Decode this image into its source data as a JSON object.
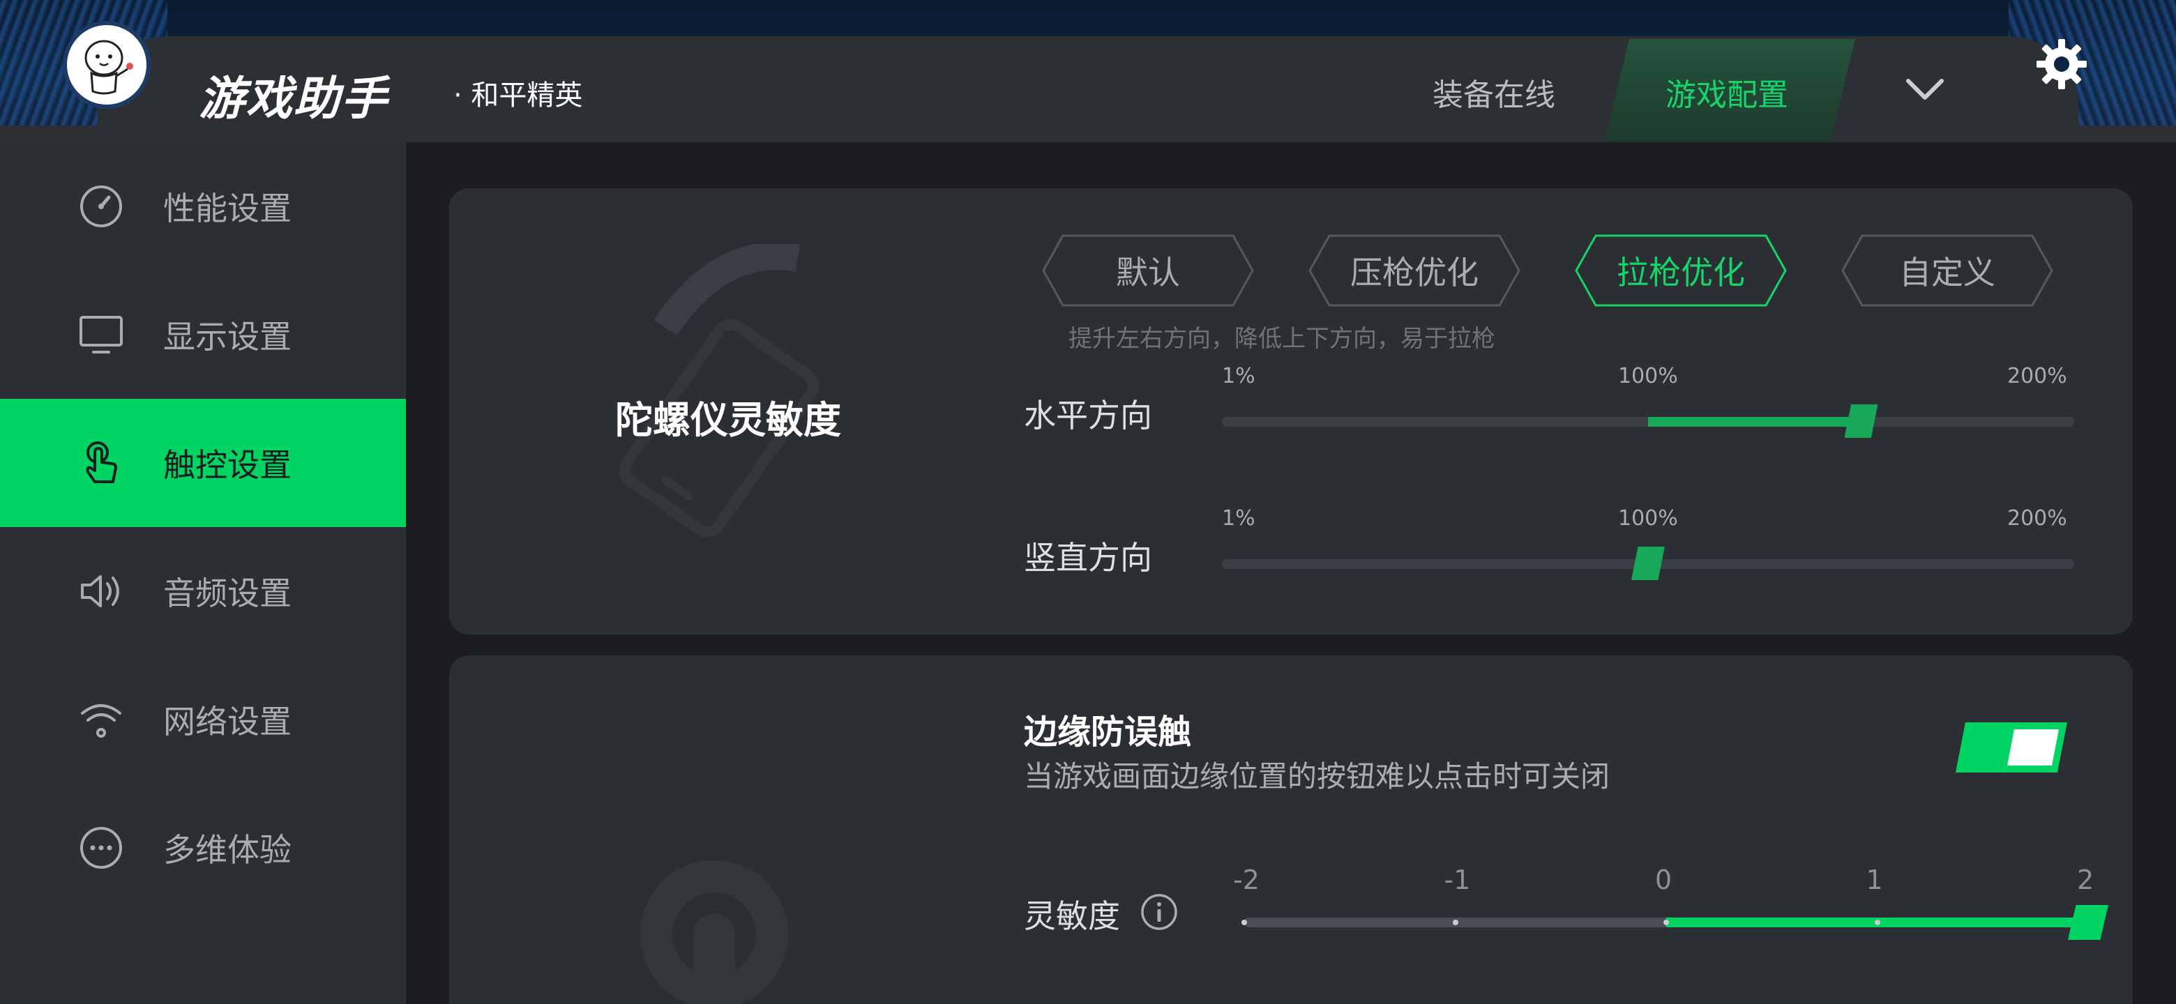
{
  "header": {
    "logo_text": "游戏助手",
    "game_name": "· 和平精英",
    "tabs": [
      {
        "label": "装备在线",
        "active": false
      },
      {
        "label": "游戏配置",
        "active": true
      }
    ],
    "accent": "#17d46a"
  },
  "sidebar": {
    "items": [
      {
        "label": "性能设置",
        "icon": "speedometer-icon",
        "active": false
      },
      {
        "label": "显示设置",
        "icon": "monitor-icon",
        "active": false
      },
      {
        "label": "触控设置",
        "icon": "touch-hand-icon",
        "active": true
      },
      {
        "label": "音频设置",
        "icon": "speaker-icon",
        "active": false
      },
      {
        "label": "网络设置",
        "icon": "wifi-icon",
        "active": false
      },
      {
        "label": "多维体验",
        "icon": "more-dots-icon",
        "active": false
      }
    ],
    "active_color": "#00d463"
  },
  "gyro": {
    "title": "陀螺仪灵敏度",
    "modes": [
      {
        "label": "默认",
        "active": false
      },
      {
        "label": "压枪优化",
        "active": false
      },
      {
        "label": "拉枪优化",
        "active": true
      },
      {
        "label": "自定义",
        "active": false
      }
    ],
    "hint": "提升左右方向，降低上下方向，易于拉枪",
    "sliders": [
      {
        "label": "水平方向",
        "min_label": "1%",
        "mid_label": "100%",
        "max_label": "200%",
        "value_percent": 150
      },
      {
        "label": "竖直方向",
        "min_label": "1%",
        "mid_label": "100%",
        "max_label": "200%",
        "value_percent": 100
      }
    ]
  },
  "edge": {
    "title": "边缘防误触",
    "description": "当游戏画面边缘位置的按钮难以点击时可关闭",
    "enabled": true,
    "sensitivity_label": "灵敏度",
    "sensitivity_ticks": [
      "-2",
      "-1",
      "0",
      "1",
      "2"
    ],
    "sensitivity_value": 2
  }
}
